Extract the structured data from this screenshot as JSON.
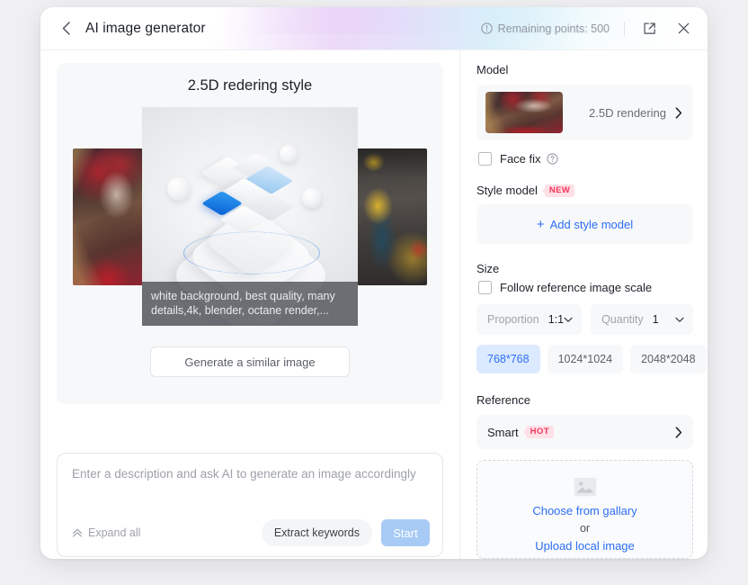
{
  "header": {
    "back_icon": "chevron-left-icon",
    "title": "AI image generator",
    "points_icon": "info-circle-icon",
    "points_label": "Remaining points: 500",
    "expand_icon": "open-in-new-icon",
    "close_icon": "close-icon"
  },
  "preview": {
    "title": "2.5D redering style",
    "caption": "white background, best quality, many details,4k, blender, octane render,...",
    "similar_button": "Generate a similar image",
    "thumbnails": [
      {
        "name": "fantasy-portrait",
        "alt": "fantasy woman with red and gold crown"
      },
      {
        "name": "iso-3d-render",
        "alt": "white and blue isometric cubes on pedestal"
      },
      {
        "name": "mech-workshop",
        "alt": "yellow and teal mech in workshop"
      }
    ]
  },
  "prompt": {
    "placeholder": "Enter a description and ask AI to generate an image accordingly",
    "value": "",
    "expand_icon": "chevron-double-up-icon",
    "expand_label": "Expand all",
    "extract_label": "Extract keywords",
    "start_label": "Start"
  },
  "panel": {
    "model": {
      "label": "Model",
      "thumb_name": "model-thumbnail",
      "value": "2.5D rendering",
      "chevron_icon": "chevron-right-icon",
      "face_fix": {
        "label": "Face fix",
        "checked": false,
        "help_icon": "question-circle-icon"
      }
    },
    "style_model": {
      "label": "Style model",
      "badge": "NEW",
      "add_label": "Add style model",
      "plus_icon": "plus-icon"
    },
    "size": {
      "label": "Size",
      "follow_scale": {
        "label": "Follow reference image scale",
        "checked": false
      },
      "proportion": {
        "label": "Proportion",
        "value": "1:1",
        "chevron_icon": "chevron-down-icon"
      },
      "quantity": {
        "label": "Quantity",
        "value": "1",
        "chevron_icon": "chevron-down-icon"
      },
      "presets": [
        {
          "label": "768*768",
          "selected": true
        },
        {
          "label": "1024*1024",
          "selected": false
        },
        {
          "label": "2048*2048",
          "selected": false
        }
      ]
    },
    "reference": {
      "label": "Reference",
      "smart_label": "Smart",
      "smart_badge": "HOT",
      "chevron_icon": "chevron-right-icon",
      "dropzone": {
        "image_icon": "image-placeholder-icon",
        "gallery_link": "Choose from gallary",
        "or": "or",
        "upload_link": "Upload local image"
      }
    }
  },
  "colors": {
    "accent_blue": "#2c6ef5",
    "chip_active_bg": "#dceaff",
    "start_btn_bg": "#a8cbf5",
    "badge_bg": "#ffe0e6",
    "badge_text": "#f5365c",
    "panel_bg": "#f7f8fa",
    "page_bg": "#f0f0f2"
  }
}
